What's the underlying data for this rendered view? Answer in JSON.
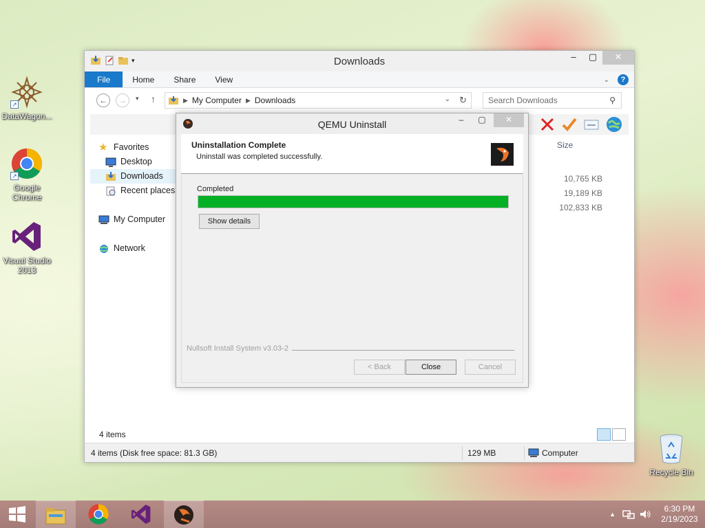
{
  "desktop": {
    "icons": [
      {
        "label": "DataWagon..."
      },
      {
        "label": "Google Chrome"
      },
      {
        "label": "Visual Studio 2013"
      },
      {
        "label": "Recycle Bin"
      }
    ]
  },
  "explorer": {
    "title": "Downloads",
    "tabs": {
      "file": "File",
      "home": "Home",
      "share": "Share",
      "view": "View"
    },
    "help": "?",
    "address": {
      "root": "My Computer",
      "current": "Downloads"
    },
    "search_placeholder": "Search Downloads",
    "column_size": "Size",
    "nav": {
      "favorites": "Favorites",
      "desktop": "Desktop",
      "downloads": "Downloads",
      "recent": "Recent places",
      "computer": "My Computer",
      "network": "Network"
    },
    "file_sizes": [
      "10,765 KB",
      "19,189 KB",
      "102,833 KB"
    ],
    "items_count": "4 items",
    "status": {
      "left": "4 items (Disk free space: 81.3 GB)",
      "size": "129 MB",
      "location": "Computer"
    }
  },
  "dialog": {
    "title": "QEMU Uninstall",
    "header_title": "Uninstallation Complete",
    "header_sub": "Uninstall was completed successfully.",
    "progress_label": "Completed",
    "progress_percent": 100,
    "show_details": "Show details",
    "nsis": "Nullsoft Install System v3.03-2",
    "back": "< Back",
    "close": "Close",
    "cancel": "Cancel"
  },
  "taskbar": {
    "time": "6:30 PM",
    "date": "2/19/2023"
  },
  "colors": {
    "progress_fill": "#06b025",
    "file_tab": "#1979ca"
  }
}
